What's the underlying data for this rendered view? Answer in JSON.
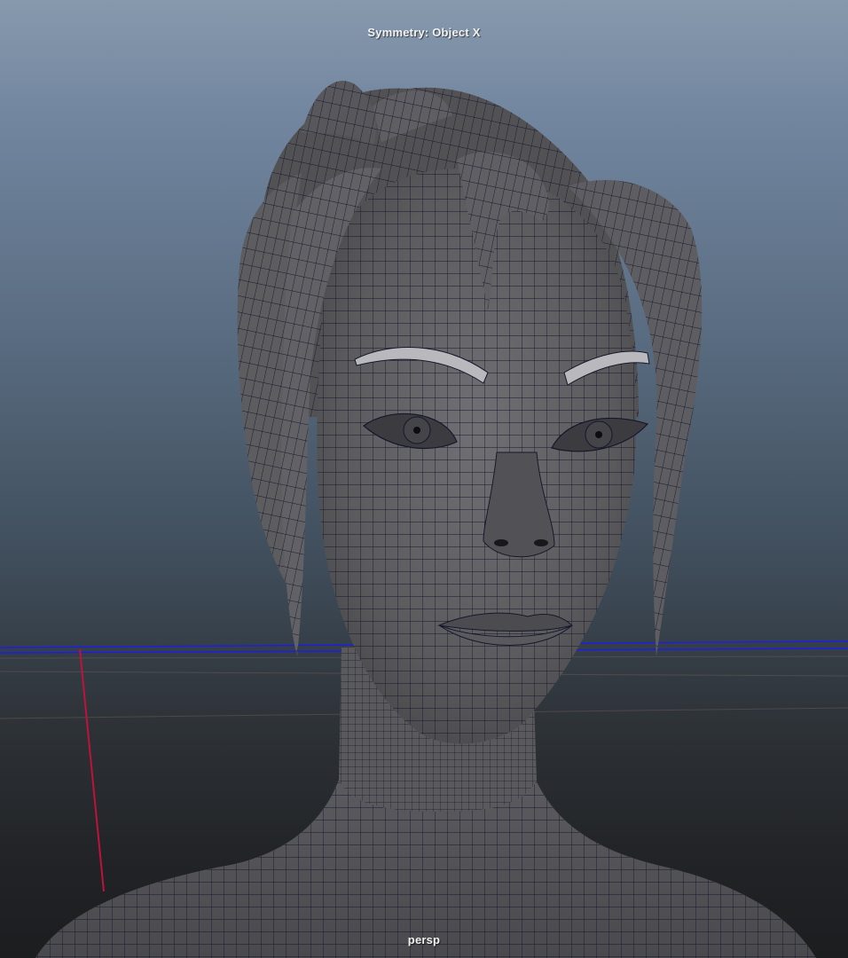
{
  "viewport": {
    "symmetry_label": "Symmetry: Object X",
    "camera_name": "persp",
    "background_top": "#8799ac",
    "background_bottom": "#1c1d1f"
  },
  "mesh": {
    "fill": "#5b5b5e",
    "wire_color": "#16172b",
    "highlight": "#6d6d71"
  },
  "axes": {
    "x_axis_color": "#c0123a",
    "z_axis_color": "#1c1cf0"
  }
}
